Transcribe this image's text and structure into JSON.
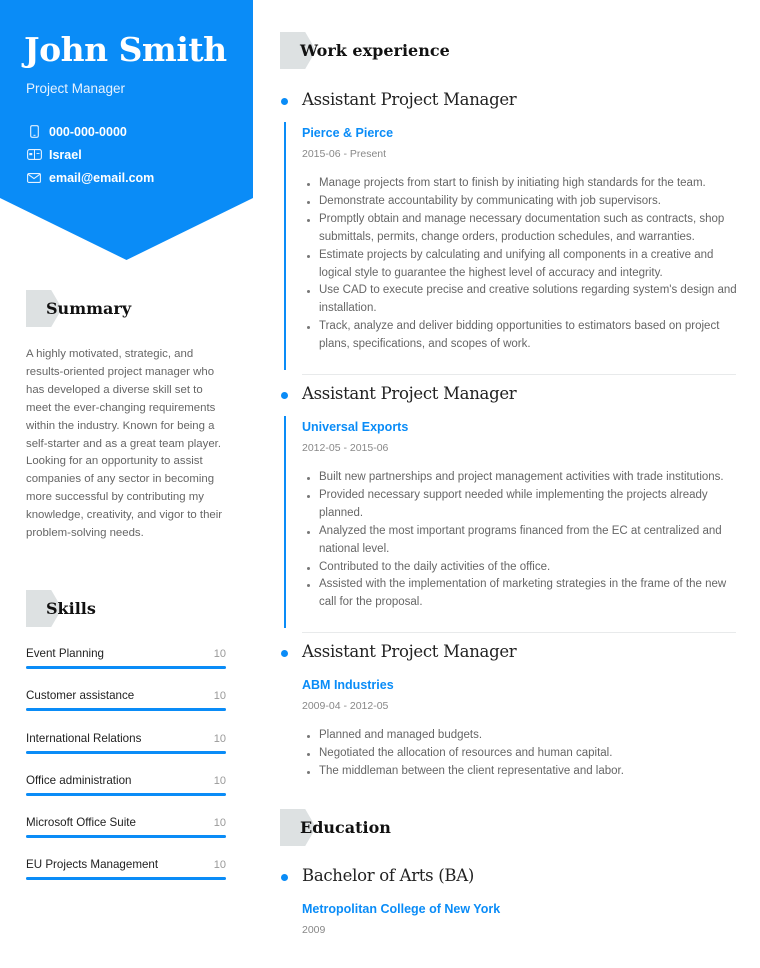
{
  "profile": {
    "name": "John Smith",
    "title": "Project Manager",
    "contacts": [
      {
        "icon": "phone-icon",
        "value": "000-000-0000"
      },
      {
        "icon": "location-icon",
        "value": "Israel"
      },
      {
        "icon": "email-icon",
        "value": "email@email.com"
      }
    ]
  },
  "summary": {
    "heading": "Summary",
    "text": "A highly motivated, strategic, and results-oriented project manager who has developed a diverse skill set to meet the ever-changing requirements within the industry. Known for being a self-starter and as a great team player. Looking for an opportunity to assist companies of any sector in becoming more successful by contributing my knowledge, creativity, and vigor to their problem-solving needs."
  },
  "skills": {
    "heading": "Skills",
    "items": [
      {
        "name": "Event Planning",
        "level": 10,
        "max": 10
      },
      {
        "name": "Customer assistance",
        "level": 10,
        "max": 10
      },
      {
        "name": "International Relations",
        "level": 10,
        "max": 10
      },
      {
        "name": "Office administration",
        "level": 10,
        "max": 10
      },
      {
        "name": "Microsoft Office Suite",
        "level": 10,
        "max": 10
      },
      {
        "name": "EU Projects Management",
        "level": 10,
        "max": 10
      }
    ]
  },
  "work": {
    "heading": "Work experience",
    "entries": [
      {
        "role": "Assistant Project Manager",
        "company": "Pierce & Pierce",
        "dates": "2015-06 - Present",
        "bullets": [
          "Manage projects from start to finish by initiating high standards for the team.",
          "Demonstrate accountability by communicating with job supervisors.",
          "Promptly obtain and manage necessary documentation such as contracts, shop submittals, permits, change orders, production schedules, and warranties.",
          "Estimate projects by calculating and unifying all components in a creative and logical style to guarantee the highest level of accuracy and integrity.",
          "Use CAD to execute precise and creative solutions regarding system's design and installation.",
          "Track, analyze and deliver bidding opportunities to estimators based on project plans, specifications, and scopes of work."
        ]
      },
      {
        "role": "Assistant Project Manager",
        "company": "Universal Exports",
        "dates": "2012-05 - 2015-06",
        "bullets": [
          "Built new partnerships and project management activities with trade institutions.",
          "Provided necessary support needed while implementing the projects already planned.",
          "Analyzed the most important programs financed from the EC at centralized and national level.",
          "Contributed to the daily activities of the office.",
          "Assisted with the implementation of marketing strategies in the frame of the new call for the proposal."
        ]
      },
      {
        "role": "Assistant Project Manager",
        "company": "ABM Industries",
        "dates": "2009-04 - 2012-05",
        "bullets": [
          "Planned and managed budgets.",
          "Negotiated the allocation of resources and human capital.",
          "The middleman between the client representative and labor."
        ]
      }
    ]
  },
  "education": {
    "heading": "Education",
    "entries": [
      {
        "degree": "Bachelor of Arts (BA)",
        "school": "Metropolitan College of New York",
        "dates": "2009"
      }
    ]
  },
  "colors": {
    "accent": "#0a8cf7",
    "badge": "#dde1e2"
  }
}
